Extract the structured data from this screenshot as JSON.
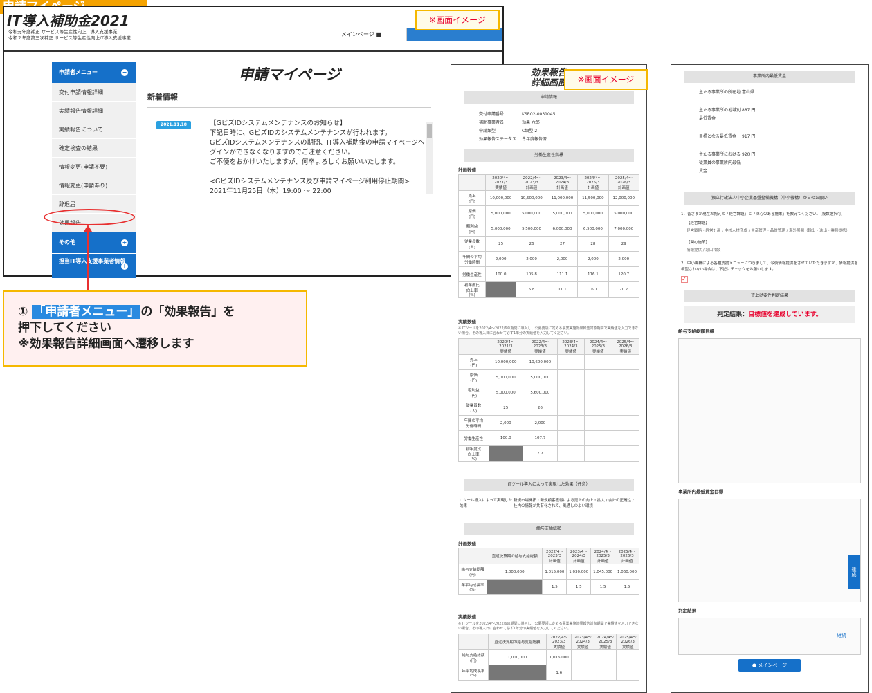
{
  "tag": "申請マイページ",
  "stamp": "※画面イメージ",
  "logo": "IT導入補助金2021",
  "sub1": "令和元年度補正 サービス等生産性向上IT導入支援事業",
  "sub2": "令和２年度第三次補正 サービス等生産性向上IT導入支援事業",
  "nav_main": "メインページ",
  "page_title": "申請マイページ",
  "news_heading": "新着情報",
  "news_date": "2021.11.18",
  "news_lines": [
    "【GビズIDシステムメンテナンスのお知らせ】",
    "下記日時に、GビズIDのシステムメンテナンスが行われます。",
    "GビズIDシステムメンテナンスの期間、IT導入補助金の申請マイページへのロ",
    "グインができなくなりますのでご注意ください。",
    "ご不便をおかけいたしますが、何卒よろしくお願いいたします。",
    "",
    "<GビズIDシステムメンテナンス及び申請マイページ利用停止期間>",
    "2021年11月25日（木）19:00 ～ 22:00"
  ],
  "menu": {
    "head": "申請者メニュー",
    "items": [
      "交付申請情報詳細",
      "実績報告情報詳細",
      "実績報告について",
      "確定検査の結果",
      "情報変更(申請不要)",
      "情報変更(申請あり)",
      "辞退届",
      "効果報告"
    ],
    "other": "その他",
    "vendor": "担当IT導入支援事業者情報"
  },
  "callout": {
    "num": "①",
    "hl": "「申請者メニュー」",
    "l1": "の「効果報告」を",
    "l2": "押下してください",
    "l3": "※効果報告詳細画面へ遷移します"
  },
  "p2": {
    "title1": "効果報告",
    "title2": "詳細画面",
    "info_h": "申請情報",
    "kv": [
      [
        "交付申請番号",
        "KSR02-0031045"
      ],
      [
        "補助事業者名",
        "効果 六郎"
      ],
      [
        "申請類型",
        "C類型-2"
      ],
      [
        "効果報告ステータス",
        "今年度報告済"
      ]
    ],
    "prod_h": "労働生産性指標",
    "plan": "計画数値",
    "actual": "実績数値",
    "cols": [
      "2020/4～\n2021/3\n実績値",
      "2022/4～\n2023/3\n計画値",
      "2023/4～\n2024/3\n計画値",
      "2024/4～\n2025/3\n計画値",
      "2025/4～\n2026/3\n計画値"
    ],
    "rows": [
      [
        "売上\n(円)",
        "10,000,000",
        "10,500,000",
        "11,000,000",
        "11,500,000",
        "12,000,000"
      ],
      [
        "原価\n(円)",
        "5,000,000",
        "5,000,000",
        "5,000,000",
        "5,000,000",
        "5,000,000"
      ],
      [
        "粗利益\n(円)",
        "5,000,000",
        "5,500,000",
        "6,000,000",
        "6,500,000",
        "7,000,000"
      ],
      [
        "従業員数\n(人)",
        "25",
        "26",
        "27",
        "28",
        "29"
      ],
      [
        "年間の平均\n労働時間",
        "2,000",
        "2,000",
        "2,000",
        "2,000",
        "2,000"
      ],
      [
        "労働生産性",
        "100.0",
        "105.8",
        "111.1",
        "116.1",
        "120.7"
      ],
      [
        "初年度比\n向上率\n(%)",
        "",
        "5.8",
        "11.1",
        "16.1",
        "20.7"
      ]
    ],
    "note": "※ ITツールを2022/4～2022/6の期間に導入し、公募要領に定める事業実施効果報告対象期間で実績値を入力できない場合、その導入日に合わせて必ず1年分の実績値を入力してください。",
    "acols": [
      "2020/4～\n2021/3\n実績値",
      "2022/4～\n2023/3\n実績値",
      "2023/4～\n2024/3\n実績値",
      "2024/4～\n2025/3\n実績値",
      "2025/4～\n2026/3\n実績値"
    ],
    "arows": [
      [
        "売上\n(円)",
        "10,000,000",
        "10,600,000"
      ],
      [
        "原価\n(円)",
        "5,000,000",
        "5,000,000"
      ],
      [
        "粗利益\n(円)",
        "5,000,000",
        "5,600,000"
      ],
      [
        "従業員数\n(人)",
        "25",
        "26"
      ],
      [
        "年間の平均\n労働時間",
        "2,000",
        "2,000"
      ],
      [
        "労働生産性",
        "100.0",
        "107.7"
      ],
      [
        "初年度比\n向上率\n(%)",
        "",
        "7.7"
      ]
    ],
    "effect_h": "ITツール導入によって実現した効果（任意）",
    "effect_k": "ITツール導入によって実現した効果",
    "effect_v": "新規市場開拓・新規顧客獲得による売上の向上・拡大 / 会計の正確性 / 社内の情報が共有化されて、風通しのよい環境",
    "wage_h": "給与支給総額",
    "wcols": [
      "直近決算期の給与支給総額",
      "2022/4～\n2023/3\n計画値",
      "2023/4～\n2024/3\n計画値",
      "2024/4～\n2025/3\n計画値",
      "2025/4～\n2026/3\n計画値"
    ],
    "wrows": [
      [
        "給与支給総額\n(円)",
        "1,000,000",
        "1,015,000",
        "1,030,000",
        "1,045,000",
        "1,060,000"
      ],
      [
        "年平均成長率\n(%)",
        "",
        "1.5",
        "1.5",
        "1.5",
        "1.5"
      ]
    ],
    "wacols": [
      "直近決算期の給与支給総額",
      "2022/4～\n2023/3\n実績値",
      "2023/4～\n2024/3\n実績値",
      "2024/4～\n2025/3\n実績値",
      "2025/4～\n2026/3\n実績値"
    ],
    "warows": [
      [
        "給与支給総額\n(円)",
        "1,000,000",
        "1,016,000"
      ],
      [
        "年平均成長率\n(%)",
        "",
        "1.6"
      ]
    ]
  },
  "p3": {
    "min_h": "事業所内最低賃金",
    "kv": [
      [
        "主たる事業所の所在地",
        "富山県"
      ],
      [
        "主たる事業所の地域別最低賃金",
        "887 円"
      ],
      [
        "目標となる最低賃金",
        "917 円"
      ],
      [
        "主たる事業所における従業員の事業所内最低賃金",
        "920 円"
      ]
    ],
    "survey_h": "独立行政法人中小企業基盤整備機構（中小機構）からのお願い",
    "q1": "1．皆さまが現在お抱えの「経営課題」と「関心のある施策」を教えてください。（複数選択可）",
    "q1a": "【経営課題】",
    "q1b": "経営戦略・経営計画 / 中核人材育成 / 生産管理・品質管理 / 海外展開（輸出・進出・業務提携）",
    "q1c": "【関心施策】",
    "q1d": "情報提供 / 窓口相談",
    "q2": "2．中小機構による各種支援メニューにつきまして、今後情報提供をさせていただきますが、情報提供を希望されない場合は、下記にチェックをお願いします。",
    "judge_h": "賃上げ要件判定結果",
    "judge_label": "判定結果：",
    "judge_val": "目標値を達成しています。",
    "wage_goal": "給与支給総額目標",
    "min_goal": "事業所内最低賃金目標",
    "result_h": "判定結果",
    "cont": "継続",
    "done": "達成",
    "main_btn": "メインページ"
  }
}
